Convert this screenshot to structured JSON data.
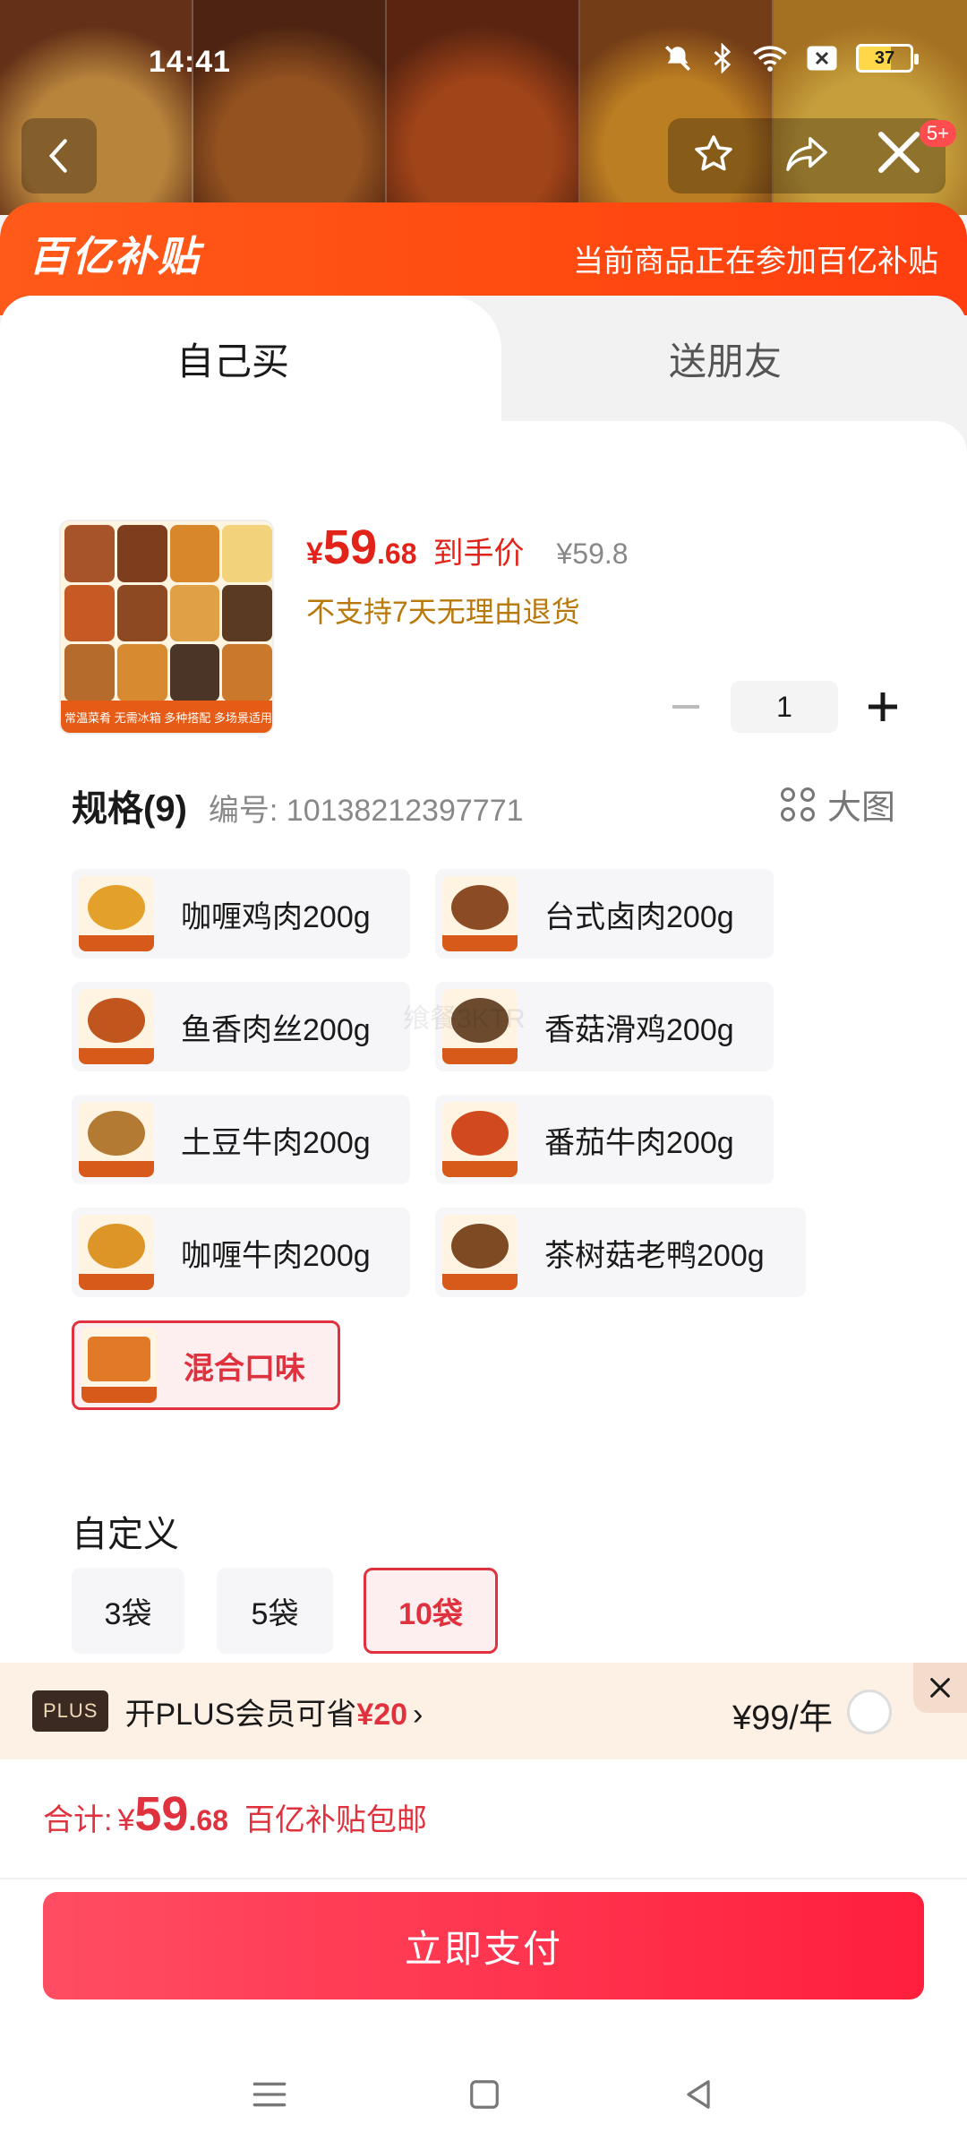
{
  "status_bar": {
    "time": "14:41",
    "battery": "37"
  },
  "top_nav": {
    "cart_badge": "5+"
  },
  "banner": {
    "logo": "百亿补贴",
    "text": "当前商品正在参加百亿补贴"
  },
  "tabs": [
    {
      "label": "自己买"
    },
    {
      "label": "送朋友"
    }
  ],
  "product": {
    "price_symbol": "¥",
    "price_int": "59",
    "price_dec": ".68",
    "price_tag": "到手价",
    "original_price": "¥59.8",
    "return_note": "不支持7天无理由退货",
    "image_footer": "常温菜肴 无需冰箱 多种搭配 多场景适用",
    "quantity": "1"
  },
  "spec": {
    "title": "规格(9)",
    "code": "编号: 10138212397771",
    "big_image_label": "大图",
    "options": [
      {
        "label": "咖喱鸡肉200g",
        "color": "#e3a02a"
      },
      {
        "label": "台式卤肉200g",
        "color": "#8b4b24"
      },
      {
        "label": "鱼香肉丝200g",
        "color": "#c1551e"
      },
      {
        "label": "香菇滑鸡200g",
        "color": "#6b4a2e"
      },
      {
        "label": "土豆牛肉200g",
        "color": "#b37a34"
      },
      {
        "label": "番茄牛肉200g",
        "color": "#d14a1f"
      },
      {
        "label": "咖喱牛肉200g",
        "color": "#dc9526"
      },
      {
        "label": "茶树菇老鸭200g",
        "color": "#7d4a24"
      },
      {
        "label": "混合口味",
        "color": "#e07a26",
        "selected": true
      }
    ]
  },
  "custom": {
    "title": "自定义",
    "chips": [
      {
        "label": "3袋"
      },
      {
        "label": "5袋"
      },
      {
        "label": "10袋",
        "selected": true
      }
    ]
  },
  "watermark": "飨餐3KTR",
  "plus": {
    "badge": "PLUS",
    "text_prefix": "开PLUS会员可省",
    "save": "¥20",
    "chevron": "›",
    "price": "¥99/年"
  },
  "footer": {
    "total_label": "合计:",
    "total_symbol": "¥",
    "total_int": "59",
    "total_dec": ".68",
    "shipping": "百亿补贴包邮",
    "pay_button": "立即支付"
  },
  "colors": {
    "accent": "#e0323e",
    "banner": "#ff4a10",
    "pay": "#ff1f3d",
    "gold_note": "#b8790a"
  }
}
